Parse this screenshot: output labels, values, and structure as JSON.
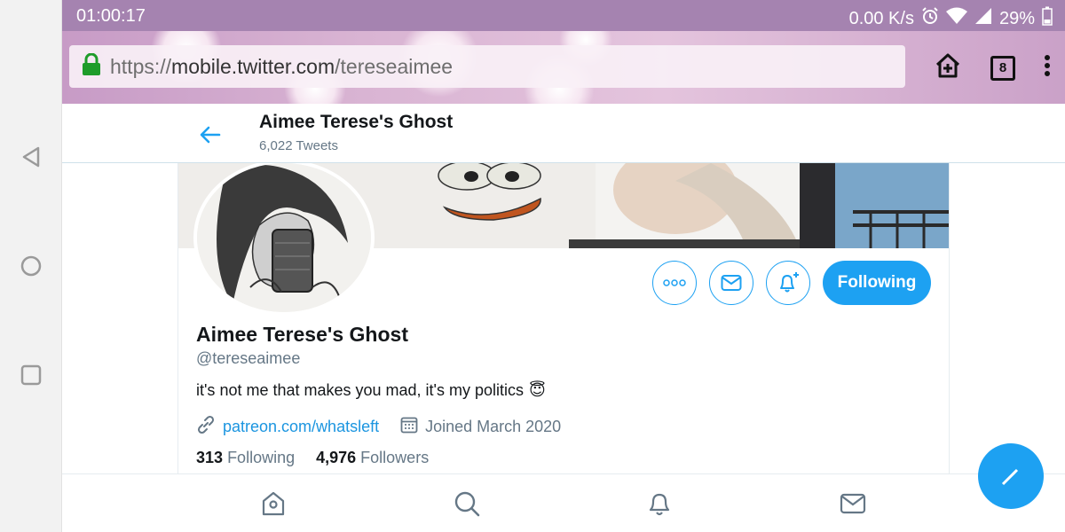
{
  "status_bar": {
    "time": "01:00:17",
    "net_speed": "0.00 K/s",
    "battery": "29%"
  },
  "browser": {
    "url_scheme": "https://",
    "url_sub": "mobile.",
    "url_host": "twitter.com",
    "url_path": "/tereseaimee",
    "tab_count": "8"
  },
  "header": {
    "title": "Aimee Terese's Ghost",
    "tweet_count": "6,022 Tweets"
  },
  "profile": {
    "name": "Aimee Terese's Ghost",
    "handle": "@tereseaimee",
    "bio": "it's not me that makes you mad, it's my politics",
    "bio_emoji": "😇",
    "link": "patreon.com/whatsleft",
    "joined": "Joined March 2020",
    "following_count": "313",
    "following_label": "Following",
    "followers_count": "4,976",
    "followers_label": "Followers",
    "follow_button": "Following"
  },
  "colors": {
    "accent": "#1da1f2",
    "status_bar": "#a583b0",
    "link": "#1b95e0"
  },
  "icons": {
    "nav": [
      "back-triangle-icon",
      "home-circle-icon",
      "recents-square-icon"
    ],
    "bottom_tabs": [
      "home-icon",
      "search-icon",
      "notifications-icon",
      "messages-icon"
    ]
  }
}
